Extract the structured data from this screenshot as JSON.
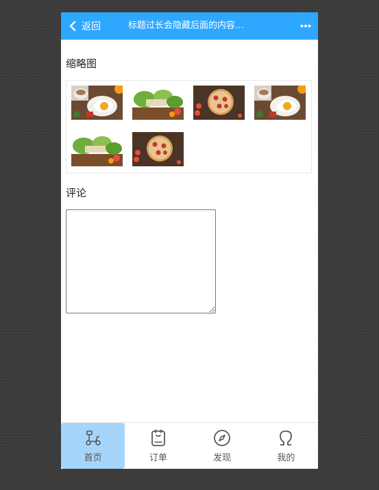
{
  "header": {
    "back_label": "返回",
    "title": "标题过长会隐藏后面的内容啊啊啊啊啊",
    "more_icon": "more-dots-icon"
  },
  "thumbnails": {
    "label": "缩略图",
    "items": [
      {
        "alt": "egg-breakfast"
      },
      {
        "alt": "salad"
      },
      {
        "alt": "pizza"
      },
      {
        "alt": "egg-breakfast"
      },
      {
        "alt": "salad"
      },
      {
        "alt": "pizza"
      }
    ]
  },
  "comment": {
    "label": "评论",
    "value": ""
  },
  "tabbar": {
    "items": [
      {
        "label": "首页",
        "icon": "scooter-icon",
        "active": true
      },
      {
        "label": "订单",
        "icon": "order-icon",
        "active": false
      },
      {
        "label": "发现",
        "icon": "compass-icon",
        "active": false
      },
      {
        "label": "我的",
        "icon": "profile-icon",
        "active": false
      }
    ]
  },
  "colors": {
    "header": "#2ea7ff",
    "active_tab": "#a6d5fb"
  }
}
